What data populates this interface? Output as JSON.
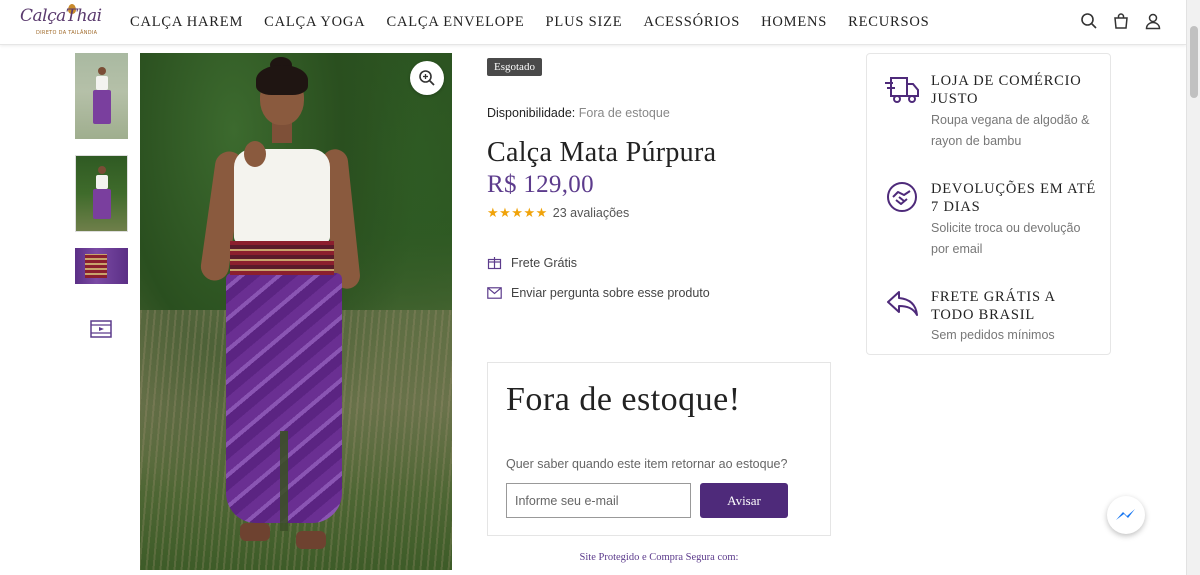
{
  "header": {
    "logo_text": "CalçaThai",
    "logo_tagline": "DIRETO DA TAILÂNDIA",
    "nav": [
      "CALÇA HAREM",
      "CALÇA YOGA",
      "CALÇA ENVELOPE",
      "PLUS SIZE",
      "ACESSÓRIOS",
      "HOMENS",
      "RECURSOS"
    ],
    "icons": [
      "search-icon",
      "bag-icon",
      "user-icon"
    ]
  },
  "gallery": {
    "thumbnails": [
      "thumbnail-1",
      "thumbnail-2",
      "thumbnail-3"
    ],
    "video_icon": "video-icon",
    "zoom_icon": "zoom-icon"
  },
  "product": {
    "badge": "Esgotado",
    "availability_label": "Disponibilidade:",
    "availability_value": "Fora de estoque",
    "title": "Calça Mata Púrpura",
    "price": "R$ 129,00",
    "rating": 5,
    "reviews": "23 avaliações",
    "shipping": "Frete Grátis",
    "ask_question": "Enviar pergunta sobre esse produto"
  },
  "stock_alert": {
    "title": "Fora de estoque!",
    "question": "Quer saber quando este item retornar ao estoque?",
    "email_placeholder": "Informe seu e-mail",
    "button": "Avisar"
  },
  "secure_text": "Site Protegido e Compra Segura com:",
  "benefits": [
    {
      "icon": "truck-icon",
      "title": "LOJA DE COMÉRCIO JUSTO",
      "text": "Roupa vegana de algodão & rayon de bambu"
    },
    {
      "icon": "handshake-icon",
      "title": "DEVOLUÇÕES EM ATÉ 7 DIAS",
      "text": "Solicite troca ou devolução por email"
    },
    {
      "icon": "return-arrow-icon",
      "title": "FRETE GRÁTIS A TODO BRASIL",
      "text": "Sem pedidos mínimos"
    }
  ],
  "colors": {
    "accent": "#5c3b8c",
    "button": "#4e2a7a",
    "stars": "#f0a30a",
    "badge": "#4a4a4a"
  }
}
